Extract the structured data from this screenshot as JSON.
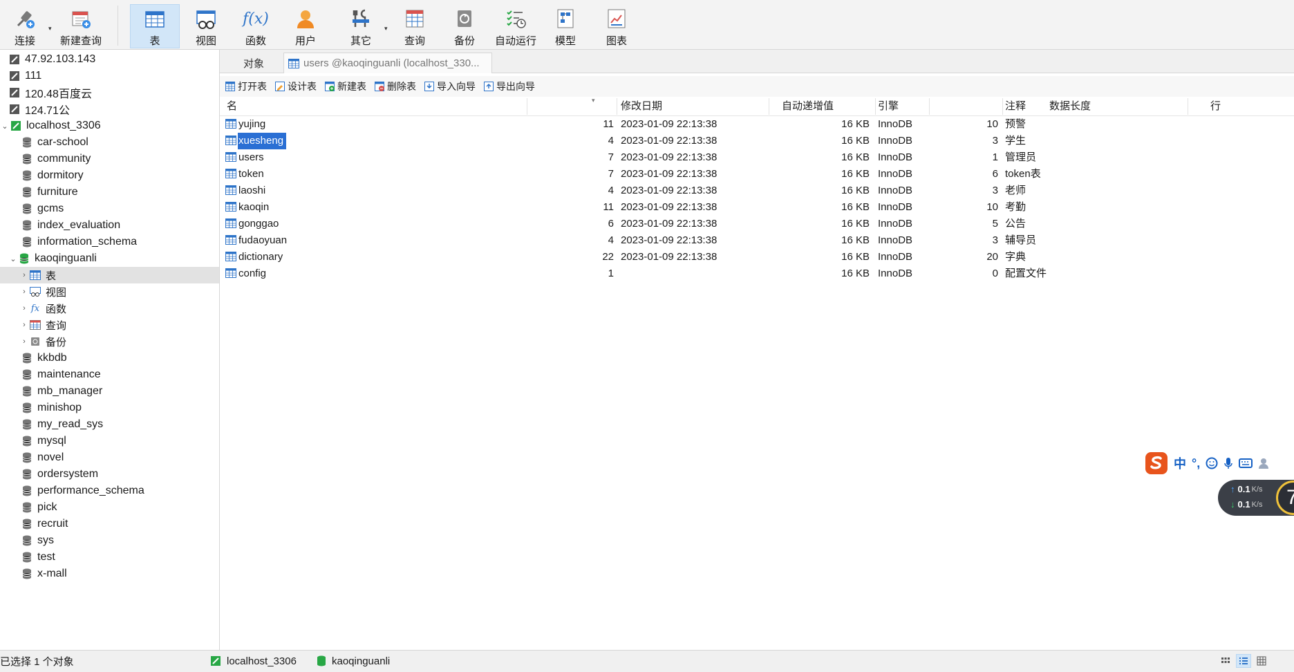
{
  "toolbar": {
    "connect": "连接",
    "new_query": "新建查询",
    "table": "表",
    "view": "视图",
    "function": "函数",
    "user": "用户",
    "other": "其它",
    "query": "查询",
    "backup": "备份",
    "auto_run": "自动运行",
    "model": "模型",
    "chart": "图表"
  },
  "tree": {
    "connections": [
      {
        "label": "47.92.103.143"
      },
      {
        "label": "111"
      },
      {
        "label": "120.48百度云"
      },
      {
        "label": "124.71公"
      },
      {
        "label": "localhost_3306"
      }
    ],
    "databases_before": [
      {
        "label": "car-school"
      },
      {
        "label": "community"
      },
      {
        "label": "dormitory"
      },
      {
        "label": "furniture"
      },
      {
        "label": "gcms"
      },
      {
        "label": "index_evaluation"
      },
      {
        "label": "information_schema"
      }
    ],
    "open_db": {
      "label": "kaoqinguanli"
    },
    "open_db_children": [
      {
        "label": "表"
      },
      {
        "label": "视图"
      },
      {
        "label": "函数"
      },
      {
        "label": "查询"
      },
      {
        "label": "备份"
      }
    ],
    "databases_after": [
      {
        "label": "kkbdb"
      },
      {
        "label": "maintenance"
      },
      {
        "label": "mb_manager"
      },
      {
        "label": "minishop"
      },
      {
        "label": "my_read_sys"
      },
      {
        "label": "mysql"
      },
      {
        "label": "novel"
      },
      {
        "label": "ordersystem"
      },
      {
        "label": "performance_schema"
      },
      {
        "label": "pick"
      },
      {
        "label": "recruit"
      },
      {
        "label": "sys"
      },
      {
        "label": "test"
      },
      {
        "label": "x-mall"
      }
    ]
  },
  "tabs": {
    "objects": "对象",
    "users_tab": "users @kaoqinguanli (localhost_330..."
  },
  "actions": {
    "open_table": "打开表",
    "design_table": "设计表",
    "new_table": "新建表",
    "delete_table": "删除表",
    "import_wizard": "导入向导",
    "export_wizard": "导出向导"
  },
  "grid": {
    "headers": {
      "name": "名",
      "auto_inc": "自动递增值",
      "modified": "修改日期",
      "data_length": "数据长度",
      "engine": "引擎",
      "rows": "行",
      "comment": "注释"
    },
    "rows": [
      {
        "name": "yujing",
        "auto_inc": "11",
        "modified": "2023-01-09 22:13:38",
        "data_length": "16 KB",
        "engine": "InnoDB",
        "rows": "10",
        "comment": "预警"
      },
      {
        "name": "xuesheng",
        "auto_inc": "4",
        "modified": "2023-01-09 22:13:38",
        "data_length": "16 KB",
        "engine": "InnoDB",
        "rows": "3",
        "comment": "学生",
        "selected": true
      },
      {
        "name": "users",
        "auto_inc": "7",
        "modified": "2023-01-09 22:13:38",
        "data_length": "16 KB",
        "engine": "InnoDB",
        "rows": "1",
        "comment": "管理员"
      },
      {
        "name": "token",
        "auto_inc": "7",
        "modified": "2023-01-09 22:13:38",
        "data_length": "16 KB",
        "engine": "InnoDB",
        "rows": "6",
        "comment": "token表"
      },
      {
        "name": "laoshi",
        "auto_inc": "4",
        "modified": "2023-01-09 22:13:38",
        "data_length": "16 KB",
        "engine": "InnoDB",
        "rows": "3",
        "comment": "老师"
      },
      {
        "name": "kaoqin",
        "auto_inc": "11",
        "modified": "2023-01-09 22:13:38",
        "data_length": "16 KB",
        "engine": "InnoDB",
        "rows": "10",
        "comment": "考勤"
      },
      {
        "name": "gonggao",
        "auto_inc": "6",
        "modified": "2023-01-09 22:13:38",
        "data_length": "16 KB",
        "engine": "InnoDB",
        "rows": "5",
        "comment": "公告"
      },
      {
        "name": "fudaoyuan",
        "auto_inc": "4",
        "modified": "2023-01-09 22:13:38",
        "data_length": "16 KB",
        "engine": "InnoDB",
        "rows": "3",
        "comment": "辅导员"
      },
      {
        "name": "dictionary",
        "auto_inc": "22",
        "modified": "2023-01-09 22:13:38",
        "data_length": "16 KB",
        "engine": "InnoDB",
        "rows": "20",
        "comment": "字典"
      },
      {
        "name": "config",
        "auto_inc": "1",
        "modified": "",
        "data_length": "16 KB",
        "engine": "InnoDB",
        "rows": "0",
        "comment": "配置文件"
      }
    ]
  },
  "status": {
    "selection": "已选择 1 个对象",
    "connection": "localhost_3306",
    "database": "kaoqinguanli"
  },
  "ime": {
    "lang": "中"
  },
  "net": {
    "up": "0.1",
    "down": "0.1",
    "unit": "K/s",
    "gauge": "7"
  },
  "colors": {
    "selection": "#2a6fd4",
    "db_icon_active": "#28a745",
    "toolbar_active": "#d2e6f8",
    "ime_brand": "#e8541c"
  }
}
